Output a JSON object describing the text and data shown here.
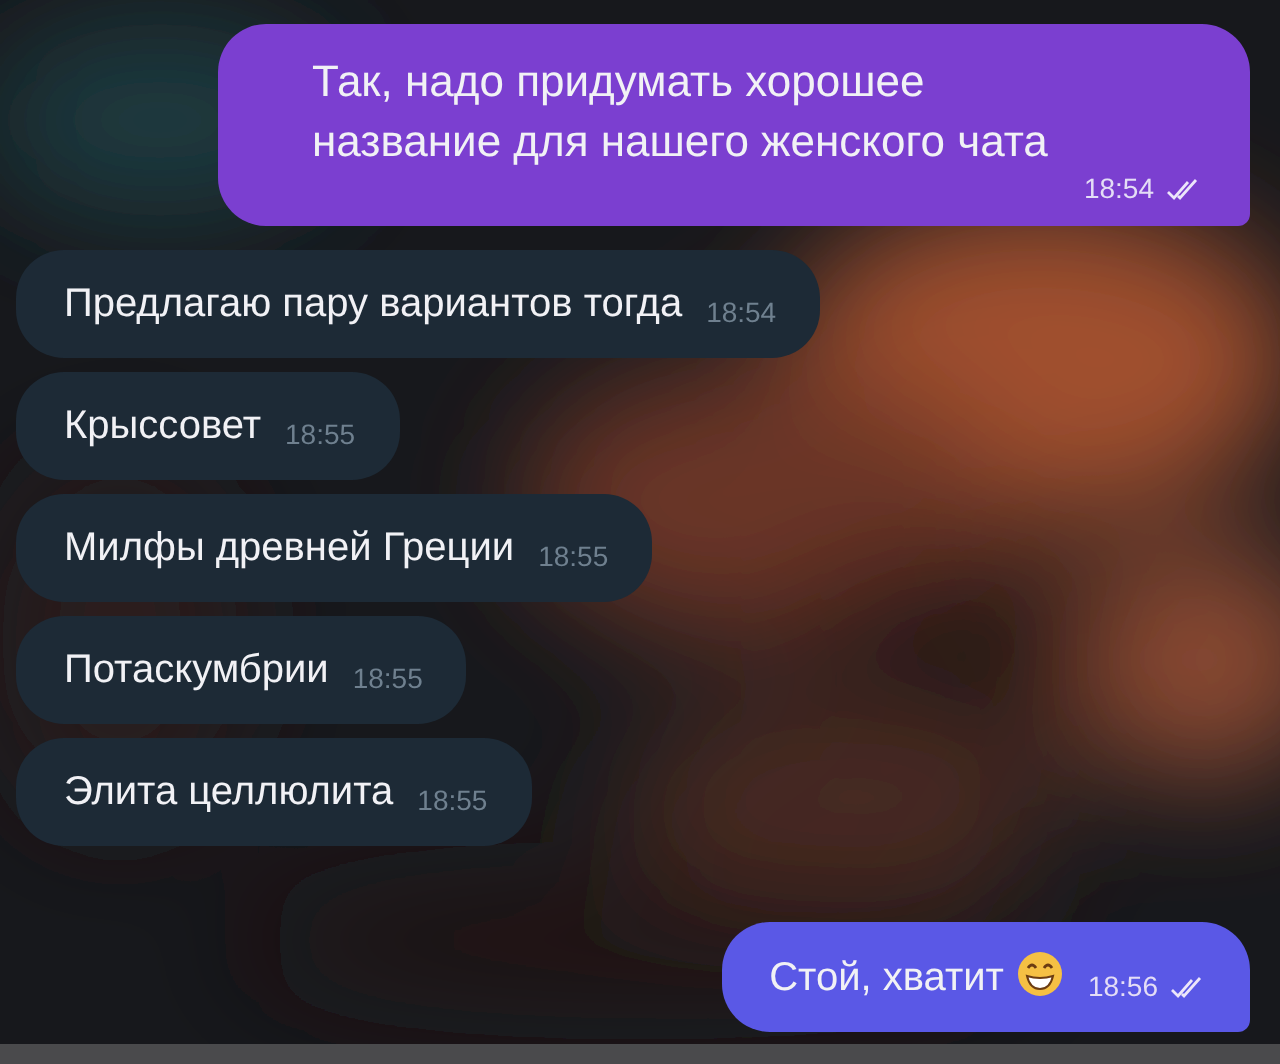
{
  "messages": [
    {
      "kind": "outgoing",
      "text": "Так, надо придумать хорошее название для нашего женского чата",
      "time": "18:54",
      "read": true,
      "emoji": false
    },
    {
      "kind": "incoming",
      "text": "Предлагаю пару вариантов тогда",
      "time": "18:54"
    },
    {
      "kind": "incoming",
      "text": "Крыссовет",
      "time": "18:55"
    },
    {
      "kind": "incoming",
      "text": "Милфы древней Греции",
      "time": "18:55"
    },
    {
      "kind": "incoming",
      "text": "Потаскумбрии",
      "time": "18:55"
    },
    {
      "kind": "incoming",
      "text": "Элита целлюлита",
      "time": "18:55"
    },
    {
      "kind": "outgoing",
      "text": "Стой, хватит",
      "time": "18:56",
      "read": true,
      "emoji": true
    }
  ]
}
